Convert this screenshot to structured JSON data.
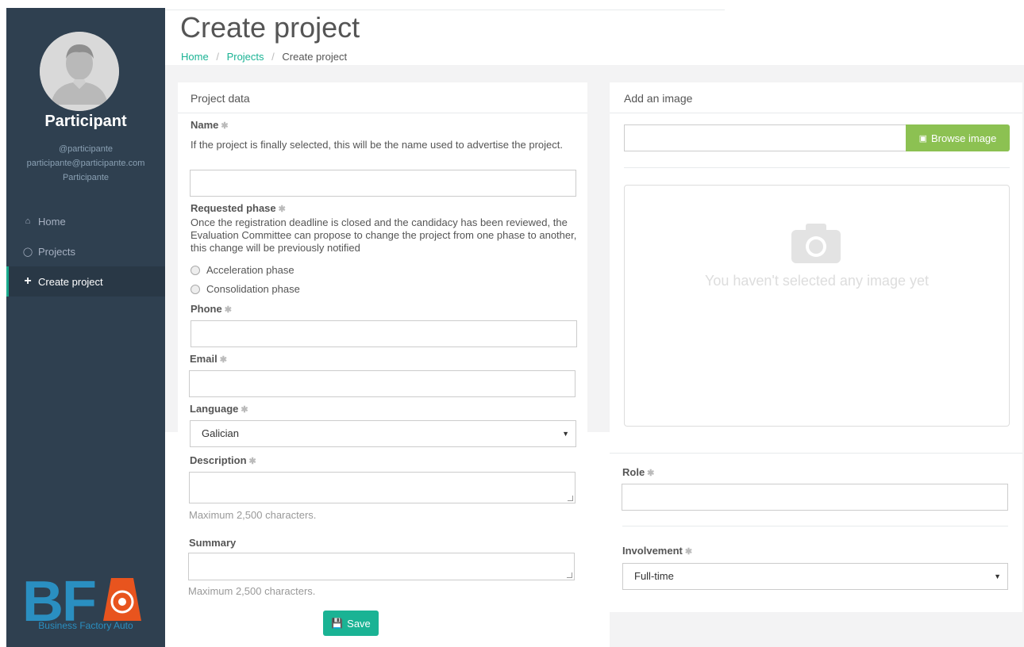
{
  "sidebar": {
    "user_name": "Participant",
    "username": "@participante",
    "email": "participante@participante.com",
    "role": "Participante",
    "nav": [
      {
        "icon": "home-icon",
        "label": "Home"
      },
      {
        "icon": "lightbulb-icon",
        "label": "Projects"
      },
      {
        "icon": "plus-icon",
        "label": "Create project",
        "active": true
      }
    ],
    "logo_text": "Business Factory Auto",
    "logo_letters": "BFA",
    "logo_color": "#2a8fc1",
    "logo_accent": "#e8541e"
  },
  "header": {
    "title": "Create project",
    "breadcrumb": {
      "home": "Home",
      "projects": "Projects",
      "current": "Create project"
    }
  },
  "project_panel": {
    "title": "Project data",
    "name_label": "Name",
    "name_help": "If the project is finally selected, this will be the name used to advertise the project.",
    "phase_label": "Requested phase",
    "phase_help": "Once the registration deadline is closed and the candidacy has been reviewed, the Evaluation Committee can propose to change the project from one phase to another, this change will be previously notified",
    "phase_options": [
      "Acceleration phase",
      "Consolidation phase"
    ],
    "phone_label": "Phone",
    "email_label": "Email",
    "language_label": "Language",
    "language_value": "Galician",
    "description_label": "Description",
    "description_help": "Maximum 2,500 characters.",
    "summary_label": "Summary",
    "summary_help": "Maximum 2,500 characters.",
    "save_label": "Save"
  },
  "image_panel": {
    "title": "Add an image",
    "browse_label": "Browse image",
    "placeholder_text": "You haven't selected any image yet",
    "role_label": "Role",
    "involvement_label": "Involvement",
    "involvement_value": "Full-time"
  },
  "colors": {
    "accent": "#1ab394",
    "sidebar": "#2f4050",
    "browse": "#8cc152"
  }
}
